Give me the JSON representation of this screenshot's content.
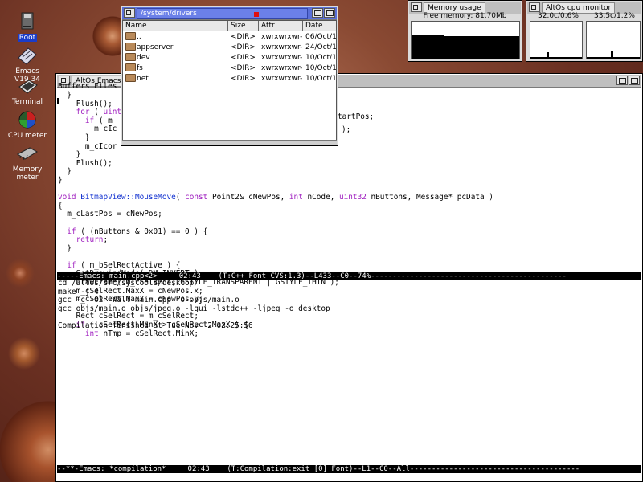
{
  "desktop": {
    "icons": [
      {
        "label": "Root",
        "icon": "disk-icon"
      },
      {
        "label": "Emacs V19.34",
        "icon": "emacs-icon"
      },
      {
        "label": "Terminal",
        "icon": "terminal-icon"
      },
      {
        "label": "CPU meter",
        "icon": "cpu-meter-icon"
      },
      {
        "label": "Memory meter",
        "icon": "memory-chip-icon"
      }
    ]
  },
  "filemanager": {
    "title": "/system/drivers",
    "columns": [
      "Name",
      "Size",
      "Attr",
      "Date"
    ],
    "rows": [
      {
        "name": "..",
        "size": "<DIR>",
        "attr": "xwrxwrxwr-",
        "date": "06/Oct/199"
      },
      {
        "name": "appserver",
        "size": "<DIR>",
        "attr": "xwrxwrxwr-",
        "date": "24/Oct/199"
      },
      {
        "name": "dev",
        "size": "<DIR>",
        "attr": "xwrxwrxwr-",
        "date": "10/Oct/199"
      },
      {
        "name": "fs",
        "size": "<DIR>",
        "attr": "xwrxwrxwr-",
        "date": "10/Oct/199"
      },
      {
        "name": "net",
        "size": "<DIR>",
        "attr": "xwrxwrxwr-",
        "date": "10/Oct/199"
      }
    ]
  },
  "memory": {
    "title": "Memory usage",
    "free_label": "Free memory: 81.70Mb"
  },
  "cpu": {
    "title": "AltOs cpu monitor",
    "cpu0": "32.0c/0.6%",
    "cpu1": "33.5c/1.2%"
  },
  "emacs": {
    "title": "AltOs Emacs V19",
    "menubar": "Buffers Files",
    "hidden_fragments": {
      "frag1": "tartPos;",
      "frag2": ");"
    },
    "code_lines": [
      "  }",
      "    Flush();",
      "    for ( uint",
      "      if ( m_",
      "        m_cIc",
      "      }",
      "      m_cIcor",
      "    }",
      "    Flush();",
      "  }",
      "}",
      "",
      "void BitmapView::MouseMove( const Point2& cNewPos, int nCode, uint32 nButtons, Message* pcData )",
      "{",
      "  m_cLastPos = cNewPos;",
      "",
      "  if ( (nButtons & 0x01) == 0 ) {",
      "    return;",
      "  }",
      "",
      "  if ( m_bSelRectActive ) {",
      "    SetDrawindMode( DM_INVERT );",
      "    DrawFrame( m_cSelRect, GSTYLE_TRANSPARENT | GSTYLE_THIN );",
      "    m_cSelRect.MaxX = cNewPos.x;",
      "    m_cSelRect.MaxY = cNewPos.y;",
      "",
      "    Rect cSelRect = m_cSelRect;",
      "    if ( cSelRect.MinX > cSelRect.MaxX ) {",
      "      int nTmp = cSelRect.MinX;"
    ],
    "modeline1": "-----Emacs: main.cpp<2>     02:43    (T:C++ Font CVS:1.3)--L433--C0--74%---------------------------------------------",
    "compile_lines": [
      "cd /altos/src/systools/desktop/",
      "make -j 4",
      "gcc -c -O2 -Wall main.cpp -o objs/main.o",
      "gcc objs/main.o objs/jpeg.o -lgui -lstdc++ -ljpeg -o desktop",
      "",
      "Compilation finished at Tue Nov  2 02:25:56"
    ],
    "modeline2": "--**-Emacs: *compilation*     02:43    (T:Compilation:exit [0] Font)--L1--C0--All---------------------------------------"
  }
}
